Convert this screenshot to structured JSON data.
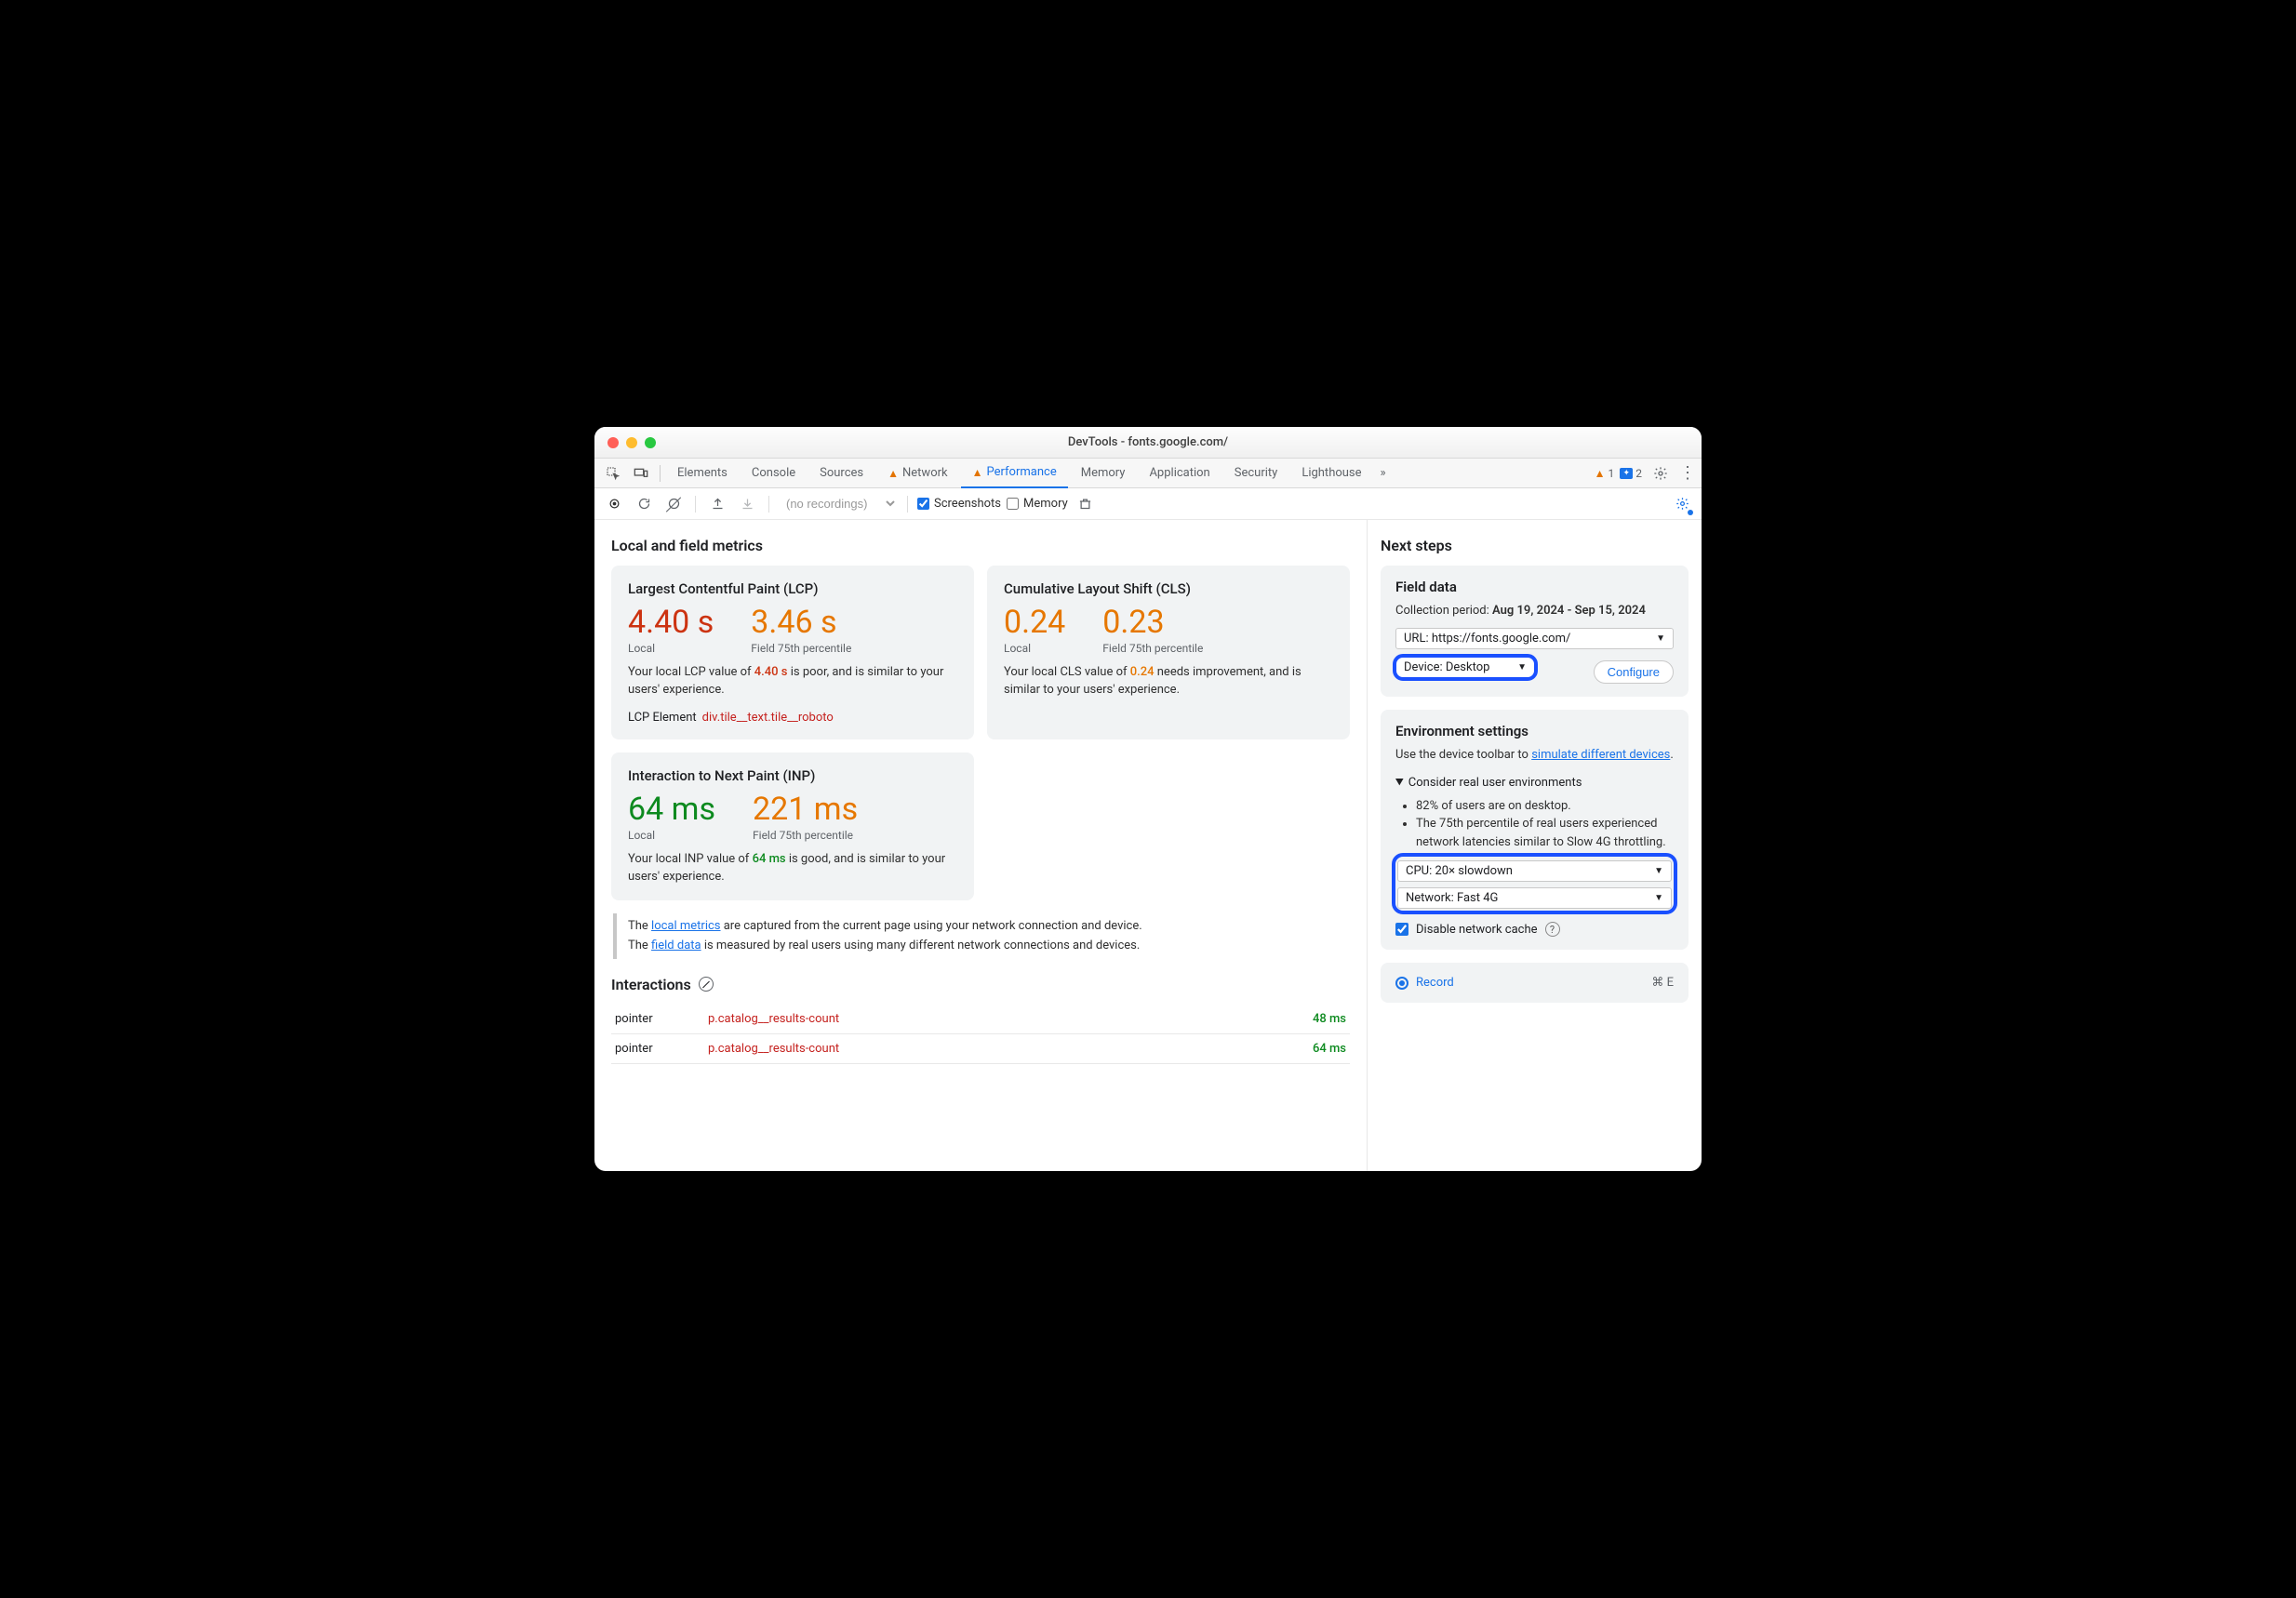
{
  "window": {
    "title": "DevTools - fonts.google.com/"
  },
  "tabs": {
    "items": [
      "Elements",
      "Console",
      "Sources",
      "Network",
      "Performance",
      "Memory",
      "Application",
      "Security",
      "Lighthouse"
    ],
    "active": "Performance",
    "warn_tabs": [
      "Network",
      "Performance"
    ],
    "more_glyph": "»",
    "warn_count": "1",
    "chat_count": "2"
  },
  "toolbar": {
    "recordings_placeholder": "(no recordings)",
    "screenshots_label": "Screenshots",
    "screenshots_checked": true,
    "memory_label": "Memory",
    "memory_checked": false
  },
  "metrics": {
    "heading": "Local and field metrics",
    "lcp": {
      "title": "Largest Contentful Paint (LCP)",
      "local_val": "4.40 s",
      "local_sub": "Local",
      "field_val": "3.46 s",
      "field_sub": "Field 75th percentile",
      "body_pre": "Your local LCP value of ",
      "body_val": "4.40 s",
      "body_post": " is poor, and is similar to your users' experience.",
      "el_label": "LCP Element",
      "el_sel": "div.tile__text.tile__roboto"
    },
    "cls": {
      "title": "Cumulative Layout Shift (CLS)",
      "local_val": "0.24",
      "local_sub": "Local",
      "field_val": "0.23",
      "field_sub": "Field 75th percentile",
      "body_pre": "Your local CLS value of ",
      "body_val": "0.24",
      "body_post": " needs improvement, and is similar to your users' experience."
    },
    "inp": {
      "title": "Interaction to Next Paint (INP)",
      "local_val": "64 ms",
      "local_sub": "Local",
      "field_val": "221 ms",
      "field_sub": "Field 75th percentile",
      "body_pre": "Your local INP value of ",
      "body_val": "64 ms",
      "body_post": " is good, and is similar to your users' experience."
    },
    "note": {
      "line1_pre": "The ",
      "line1_link": "local metrics",
      "line1_post": " are captured from the current page using your network connection and device.",
      "line2_pre": "The ",
      "line2_link": "field data",
      "line2_post": " is measured by real users using many different network connections and devices."
    }
  },
  "interactions": {
    "heading": "Interactions",
    "rows": [
      {
        "type": "pointer",
        "selector": "p.catalog__results-count",
        "time": "48 ms"
      },
      {
        "type": "pointer",
        "selector": "p.catalog__results-count",
        "time": "64 ms"
      }
    ]
  },
  "nextsteps": {
    "heading": "Next steps",
    "field": {
      "title": "Field data",
      "period_label": "Collection period: ",
      "period_val": "Aug 19, 2024 - Sep 15, 2024",
      "url_label": "URL: https://fonts.google.com/",
      "device_label": "Device: Desktop",
      "configure": "Configure"
    },
    "env": {
      "title": "Environment settings",
      "hint_pre": "Use the device toolbar to ",
      "hint_link": "simulate different devices",
      "hint_post": ".",
      "summary": "Consider real user environments",
      "bullets": [
        "82% of users are on desktop.",
        "The 75th percentile of real users experienced network latencies similar to Slow 4G throttling."
      ],
      "cpu": "CPU: 20× slowdown",
      "net": "Network: Fast 4G",
      "cache_label": "Disable network cache",
      "cache_checked": true
    },
    "record": {
      "label": "Record",
      "shortcut": "⌘ E"
    }
  }
}
